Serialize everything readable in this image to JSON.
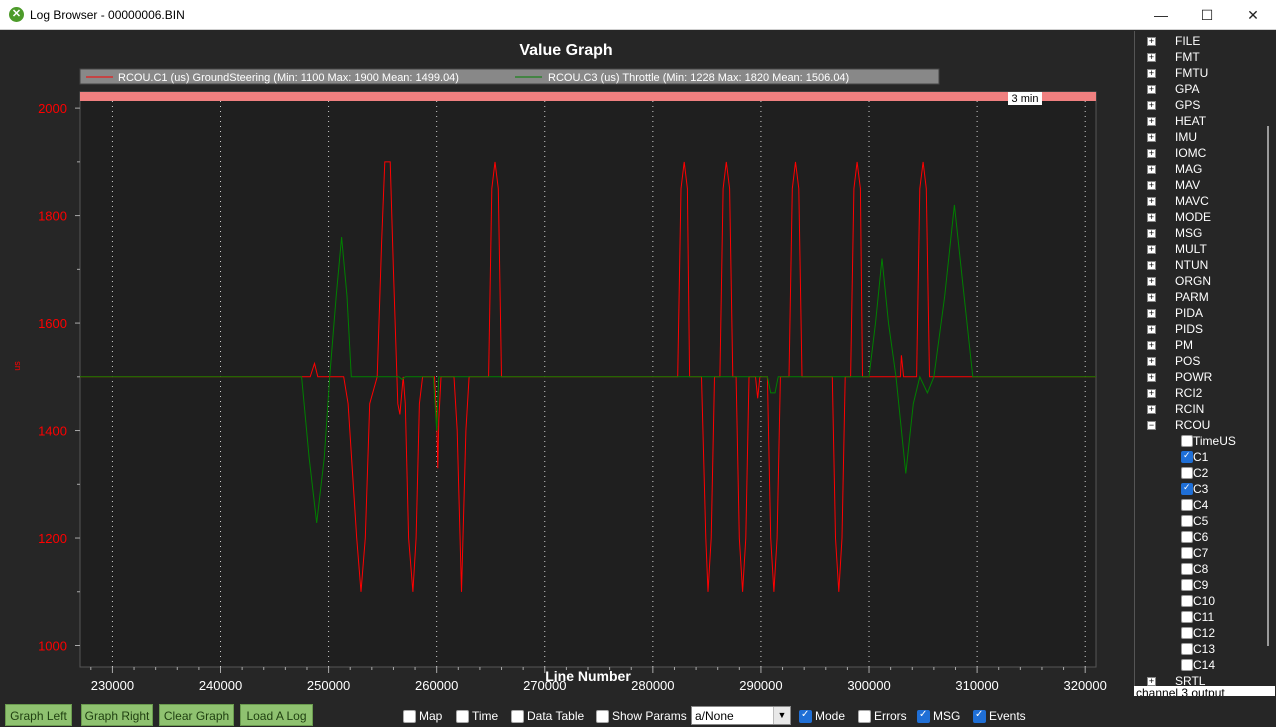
{
  "window": {
    "title": "Log Browser - 00000006.BIN",
    "minimize_icon": "minimize-icon",
    "maximize_icon": "maximize-icon",
    "close_icon": "close-icon"
  },
  "graph": {
    "title": "Value Graph",
    "legend": [
      {
        "label": "RCOU.C1 (us) GroundSteering (Min: 1100 Max: 1900 Mean: 1499.04)",
        "color": "#ff0000"
      },
      {
        "label": "RCOU.C3 (us) Throttle (Min: 1228 Max: 1820 Mean: 1506.04)",
        "color": "#008000"
      }
    ],
    "time_badge": "3 min",
    "ylabel": "us",
    "xlabel": "Line Number"
  },
  "chart_data": {
    "type": "line",
    "xlabel": "Line Number",
    "ylabel": "us",
    "xlim": [
      227000,
      321000
    ],
    "ylim": [
      960,
      2030
    ],
    "xticks": [
      230000,
      240000,
      250000,
      260000,
      270000,
      280000,
      290000,
      300000,
      310000,
      320000
    ],
    "yticks": [
      1000,
      1200,
      1400,
      1600,
      1800,
      2000
    ],
    "grid": true,
    "legend_position": "top",
    "series": [
      {
        "name": "RCOU.C1 (us) GroundSteering",
        "color": "#ff0000",
        "points": [
          [
            227000,
            1500
          ],
          [
            247500,
            1500
          ],
          [
            248300,
            1500
          ],
          [
            248700,
            1525
          ],
          [
            249000,
            1500
          ],
          [
            251400,
            1500
          ],
          [
            251800,
            1450
          ],
          [
            252600,
            1200
          ],
          [
            253000,
            1100
          ],
          [
            253400,
            1200
          ],
          [
            253800,
            1450
          ],
          [
            254500,
            1500
          ],
          [
            254900,
            1750
          ],
          [
            255200,
            1900
          ],
          [
            255700,
            1900
          ],
          [
            256000,
            1700
          ],
          [
            256400,
            1450
          ],
          [
            256600,
            1430
          ],
          [
            256900,
            1500
          ],
          [
            257100,
            1450
          ],
          [
            257400,
            1200
          ],
          [
            257800,
            1100
          ],
          [
            258100,
            1200
          ],
          [
            258400,
            1450
          ],
          [
            258700,
            1500
          ],
          [
            259800,
            1500
          ],
          [
            260000,
            1420
          ],
          [
            260100,
            1330
          ],
          [
            260200,
            1420
          ],
          [
            260400,
            1500
          ],
          [
            261600,
            1500
          ],
          [
            261900,
            1400
          ],
          [
            262300,
            1100
          ],
          [
            262700,
            1400
          ],
          [
            263000,
            1500
          ],
          [
            264800,
            1500
          ],
          [
            265100,
            1850
          ],
          [
            265400,
            1900
          ],
          [
            265700,
            1850
          ],
          [
            266000,
            1500
          ],
          [
            282300,
            1500
          ],
          [
            282600,
            1850
          ],
          [
            282900,
            1900
          ],
          [
            283200,
            1850
          ],
          [
            283400,
            1500
          ],
          [
            284500,
            1500
          ],
          [
            284900,
            1200
          ],
          [
            285100,
            1100
          ],
          [
            285400,
            1200
          ],
          [
            285700,
            1500
          ],
          [
            286200,
            1500
          ],
          [
            286500,
            1850
          ],
          [
            286800,
            1900
          ],
          [
            287100,
            1850
          ],
          [
            287400,
            1500
          ],
          [
            287700,
            1500
          ],
          [
            288000,
            1200
          ],
          [
            288300,
            1100
          ],
          [
            288600,
            1200
          ],
          [
            288900,
            1500
          ],
          [
            289500,
            1500
          ],
          [
            289700,
            1460
          ],
          [
            289900,
            1500
          ],
          [
            290600,
            1500
          ],
          [
            290900,
            1200
          ],
          [
            291200,
            1100
          ],
          [
            291500,
            1200
          ],
          [
            291800,
            1500
          ],
          [
            292600,
            1500
          ],
          [
            292900,
            1850
          ],
          [
            293200,
            1900
          ],
          [
            293500,
            1850
          ],
          [
            293800,
            1500
          ],
          [
            295500,
            1500
          ],
          [
            296600,
            1500
          ],
          [
            296900,
            1200
          ],
          [
            297200,
            1100
          ],
          [
            297500,
            1200
          ],
          [
            297800,
            1500
          ],
          [
            298300,
            1500
          ],
          [
            298600,
            1850
          ],
          [
            298900,
            1900
          ],
          [
            299200,
            1850
          ],
          [
            299400,
            1500
          ],
          [
            299800,
            1500
          ],
          [
            302900,
            1500
          ],
          [
            303000,
            1540
          ],
          [
            303200,
            1500
          ],
          [
            304400,
            1500
          ],
          [
            304700,
            1850
          ],
          [
            305000,
            1900
          ],
          [
            305300,
            1850
          ],
          [
            305600,
            1500
          ],
          [
            321000,
            1500
          ]
        ]
      },
      {
        "name": "RCOU.C3 (us) Throttle",
        "color": "#008000",
        "points": [
          [
            227000,
            1500
          ],
          [
            247500,
            1500
          ],
          [
            248200,
            1350
          ],
          [
            248900,
            1228
          ],
          [
            249600,
            1350
          ],
          [
            250100,
            1500
          ],
          [
            250700,
            1650
          ],
          [
            251200,
            1760
          ],
          [
            251700,
            1650
          ],
          [
            252100,
            1500
          ],
          [
            256500,
            1500
          ],
          [
            256800,
            1495
          ],
          [
            257100,
            1500
          ],
          [
            259700,
            1500
          ],
          [
            260000,
            1400
          ],
          [
            260200,
            1500
          ],
          [
            290600,
            1500
          ],
          [
            290900,
            1470
          ],
          [
            291300,
            1470
          ],
          [
            291600,
            1500
          ],
          [
            300000,
            1500
          ],
          [
            300600,
            1600
          ],
          [
            301200,
            1720
          ],
          [
            301800,
            1600
          ],
          [
            302500,
            1500
          ],
          [
            303400,
            1320
          ],
          [
            304100,
            1450
          ],
          [
            304700,
            1500
          ],
          [
            305400,
            1470
          ],
          [
            306000,
            1500
          ],
          [
            307000,
            1650
          ],
          [
            307900,
            1820
          ],
          [
            308800,
            1650
          ],
          [
            309600,
            1500
          ],
          [
            321000,
            1500
          ]
        ]
      }
    ]
  },
  "tree": {
    "items": [
      "FILE",
      "FMT",
      "FMTU",
      "GPA",
      "GPS",
      "HEAT",
      "IMU",
      "IOMC",
      "MAG",
      "MAV",
      "MAVC",
      "MODE",
      "MSG",
      "MULT",
      "NTUN",
      "ORGN",
      "PARM",
      "PIDA",
      "PIDS",
      "PM",
      "POS",
      "POWR",
      "RCI2",
      "RCIN",
      "RCOU"
    ],
    "rcou_children": [
      {
        "label": "TimeUS",
        "checked": false
      },
      {
        "label": "C1",
        "checked": true
      },
      {
        "label": "C2",
        "checked": false
      },
      {
        "label": "C3",
        "checked": true
      },
      {
        "label": "C4",
        "checked": false
      },
      {
        "label": "C5",
        "checked": false
      },
      {
        "label": "C6",
        "checked": false
      },
      {
        "label": "C7",
        "checked": false
      },
      {
        "label": "C8",
        "checked": false
      },
      {
        "label": "C9",
        "checked": false
      },
      {
        "label": "C10",
        "checked": false
      },
      {
        "label": "C11",
        "checked": false
      },
      {
        "label": "C12",
        "checked": false
      },
      {
        "label": "C13",
        "checked": false
      },
      {
        "label": "C14",
        "checked": false
      }
    ],
    "after": "SRTL"
  },
  "status": "channel 3 output",
  "buttons": {
    "graph_left": "Graph Left",
    "graph_right": "Graph Right",
    "clear_graph": "Clear Graph",
    "load_log": "Load A Log"
  },
  "options": {
    "map": {
      "label": "Map",
      "checked": false
    },
    "time": {
      "label": "Time",
      "checked": false
    },
    "data_table": {
      "label": "Data Table",
      "checked": false
    },
    "show_params": {
      "label": "Show Params",
      "checked": false
    },
    "mode": {
      "label": "Mode",
      "checked": true
    },
    "errors": {
      "label": "Errors",
      "checked": false
    },
    "msg": {
      "label": "MSG",
      "checked": true
    },
    "events": {
      "label": "Events",
      "checked": true
    }
  },
  "dropdown": {
    "value": "a/None"
  }
}
